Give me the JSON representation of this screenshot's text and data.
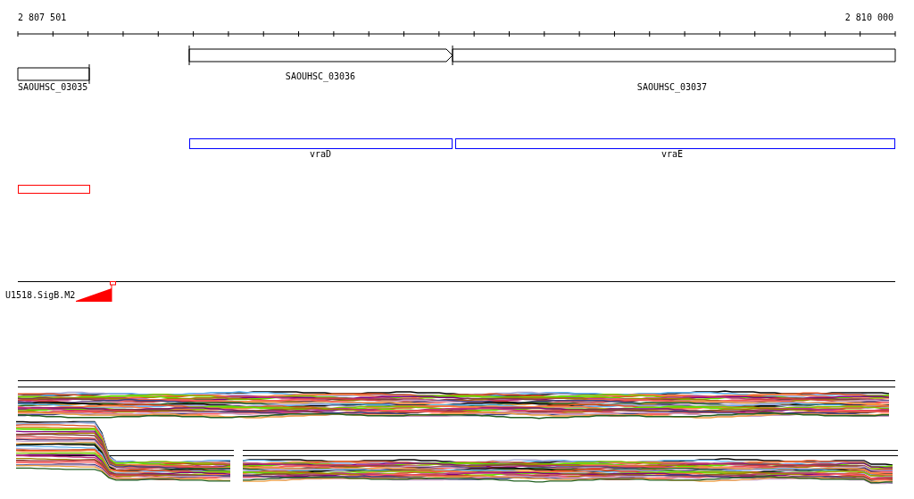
{
  "ruler": {
    "start_label": "2 807 501",
    "end_label": "2 810 000"
  },
  "genes": [
    {
      "name": "SAOUHSC_03035",
      "kind": "box"
    },
    {
      "name": "SAOUHSC_03036",
      "kind": "arrow"
    },
    {
      "name": "SAOUHSC_03037",
      "kind": "box"
    }
  ],
  "operons": [
    {
      "name": "vraD"
    },
    {
      "name": "vraE"
    }
  ],
  "motif_track": {
    "label": "U1518.SigB.M2"
  }
}
